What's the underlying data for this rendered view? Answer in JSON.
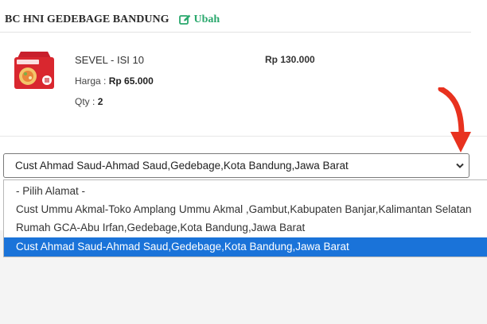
{
  "store": {
    "name": "BC HNI GEDEBAGE BANDUNG",
    "edit_label": "Ubah"
  },
  "product": {
    "name": "SEVEL - ISI 10",
    "total": "Rp 130.000",
    "price_label": "Harga :",
    "price_value": "Rp 65.000",
    "qty_label": "Qty :",
    "qty_value": "2"
  },
  "address_select": {
    "selected_value": "Cust Ahmad Saud-Ahmad Saud,Gedebage,Kota Bandung,Jawa Barat",
    "options": [
      "- Pilih Alamat -",
      "Cust Ummu Akmal-Toko Amplang Ummu Akmal ,Gambut,Kabupaten Banjar,Kalimantan Selatan",
      "Rumah GCA-Abu Irfan,Gedebage,Kota Bandung,Jawa Barat",
      "Cust Ahmad Saud-Ahmad Saud,Gedebage,Kota Bandung,Jawa Barat"
    ],
    "selected_index": 3
  },
  "colors": {
    "accent_green": "#2aa86d",
    "selected_blue": "#1a73d9",
    "annotation_red": "#e8321f"
  },
  "icons": {
    "edit": "edit-icon",
    "chevron": "chevron-down-icon",
    "annotation": "red-arrow-icon"
  }
}
